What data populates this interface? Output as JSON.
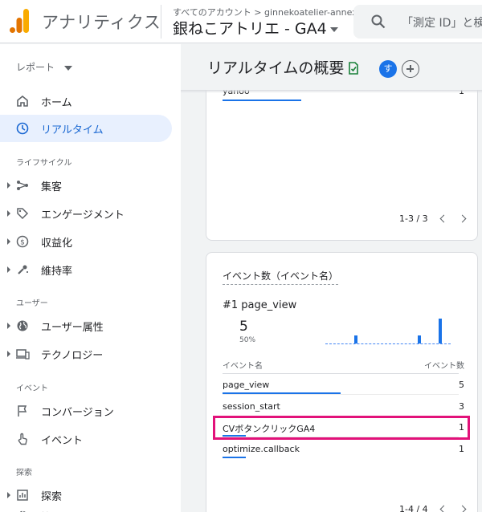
{
  "header": {
    "app_name": "アナリティクス",
    "breadcrumb": "すべてのアカウント > ginnekoatelier-annex",
    "property_name": "銀ねこアトリエ - GA4",
    "search_placeholder": "「測定 ID」と検索"
  },
  "sidebar": {
    "report_dropdown": "レポート",
    "items": [
      {
        "label": "ホーム",
        "icon": "home-icon"
      },
      {
        "label": "リアルタイム",
        "icon": "clock-icon",
        "active": true
      }
    ],
    "lifecycle_header": "ライフサイクル",
    "lifecycle": [
      {
        "label": "集客",
        "icon": "acquisition-icon"
      },
      {
        "label": "エンゲージメント",
        "icon": "tag-icon"
      },
      {
        "label": "収益化",
        "icon": "dollar-icon"
      },
      {
        "label": "維持率",
        "icon": "retention-icon"
      }
    ],
    "user_header": "ユーザー",
    "user": [
      {
        "label": "ユーザー属性",
        "icon": "globe-icon"
      },
      {
        "label": "テクノロジー",
        "icon": "devices-icon"
      }
    ],
    "event_header": "イベント",
    "event": [
      {
        "label": "コンバージョン",
        "icon": "flag-icon"
      },
      {
        "label": "イベント",
        "icon": "touch-icon"
      }
    ],
    "explore_header": "探索",
    "explore": [
      {
        "label": "探索",
        "icon": "explore-icon"
      },
      {
        "label": "管理",
        "icon": "gear-icon"
      }
    ]
  },
  "main": {
    "title": "リアルタイムの概要",
    "avatar_initial": "す",
    "card1": {
      "last_row_label": "yahoo",
      "last_row_value": "1",
      "pager": "1-3 / 3"
    },
    "card2": {
      "title": "イベント数（イベント名）",
      "top_label": "#1  page_view",
      "top_value": "5",
      "top_pct": "50%",
      "col_name": "イベント名",
      "col_count": "イベント数",
      "rows": [
        {
          "name": "page_view",
          "count": "5",
          "fraction": 1.0
        },
        {
          "name": "session_start",
          "count": "3",
          "fraction": 0.0
        },
        {
          "name": "CVボタンクリックGA4",
          "count": "1",
          "fraction": 0.2
        },
        {
          "name": "optimize.callback",
          "count": "1",
          "fraction": 0.2
        }
      ],
      "pager": "1-4 / 4",
      "sparkline": [
        1,
        1,
        3
      ]
    }
  },
  "colors": {
    "accent": "#1a73e8",
    "highlight": "#e2127a",
    "active_bg": "#e8f0fe"
  }
}
